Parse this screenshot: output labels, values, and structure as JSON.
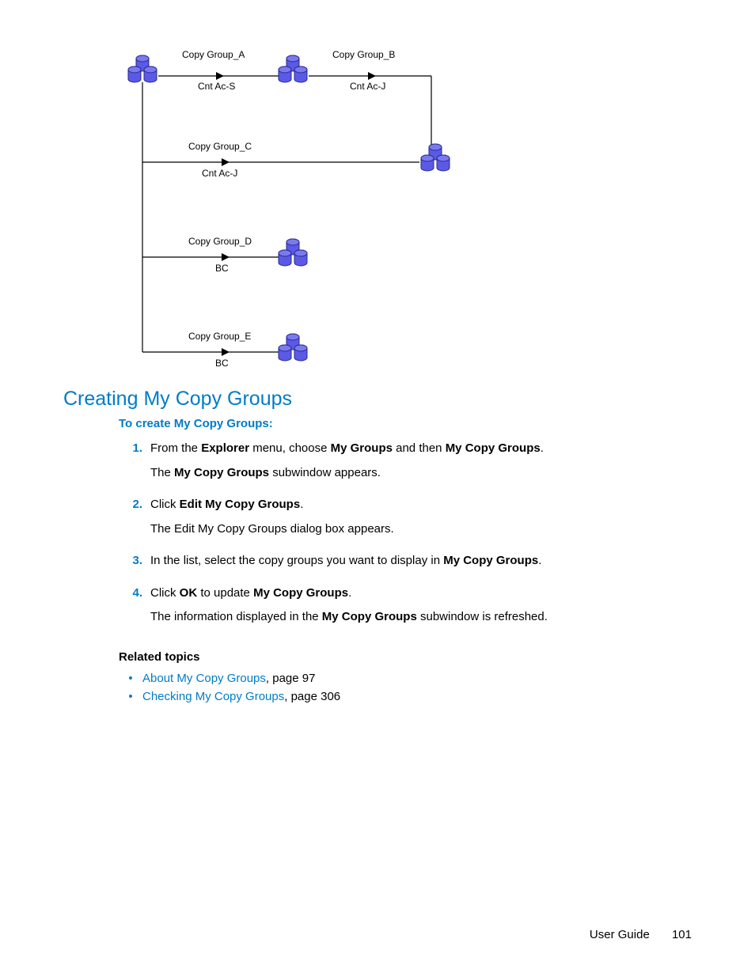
{
  "diagram": {
    "labels": {
      "cga": "Copy Group_A",
      "cgb": "Copy Group_B",
      "cgc": "Copy Group_C",
      "cgd": "Copy Group_D",
      "cge": "Copy Group_E",
      "cnt_acs": "Cnt Ac-S",
      "cnt_acj1": "Cnt Ac-J",
      "cnt_acj2": "Cnt Ac-J",
      "bc1": "BC",
      "bc2": "BC"
    }
  },
  "heading": "Creating My Copy Groups",
  "subheading": "To create My Copy Groups:",
  "steps": [
    {
      "num": "1.",
      "lines": [
        {
          "parts": [
            {
              "t": "From the "
            },
            {
              "t": "Explorer",
              "b": true
            },
            {
              "t": " menu, choose "
            },
            {
              "t": "My Groups",
              "b": true
            },
            {
              "t": " and then "
            },
            {
              "t": "My Copy Groups",
              "b": true
            },
            {
              "t": "."
            }
          ]
        },
        {
          "parts": [
            {
              "t": "The "
            },
            {
              "t": "My Copy Groups",
              "b": true
            },
            {
              "t": " subwindow appears."
            }
          ]
        }
      ]
    },
    {
      "num": "2.",
      "lines": [
        {
          "parts": [
            {
              "t": "Click "
            },
            {
              "t": "Edit My Copy Groups",
              "b": true
            },
            {
              "t": "."
            }
          ]
        },
        {
          "parts": [
            {
              "t": "The Edit My Copy Groups dialog box appears."
            }
          ]
        }
      ]
    },
    {
      "num": "3.",
      "lines": [
        {
          "parts": [
            {
              "t": "In the list, select the copy groups you want to display in "
            },
            {
              "t": "My Copy Groups",
              "b": true
            },
            {
              "t": "."
            }
          ]
        }
      ]
    },
    {
      "num": "4.",
      "lines": [
        {
          "parts": [
            {
              "t": "Click "
            },
            {
              "t": "OK",
              "b": true
            },
            {
              "t": " to update "
            },
            {
              "t": "My Copy Groups",
              "b": true
            },
            {
              "t": "."
            }
          ]
        },
        {
          "parts": [
            {
              "t": "The information displayed in the "
            },
            {
              "t": "My Copy Groups",
              "b": true
            },
            {
              "t": " subwindow is refreshed."
            }
          ]
        }
      ]
    }
  ],
  "related_heading": "Related topics",
  "related": [
    {
      "link": "About My Copy Groups",
      "suffix": ", page 97"
    },
    {
      "link": "Checking My Copy Groups",
      "suffix": ", page 306"
    }
  ],
  "footer": {
    "label": "User Guide",
    "page": "101"
  }
}
